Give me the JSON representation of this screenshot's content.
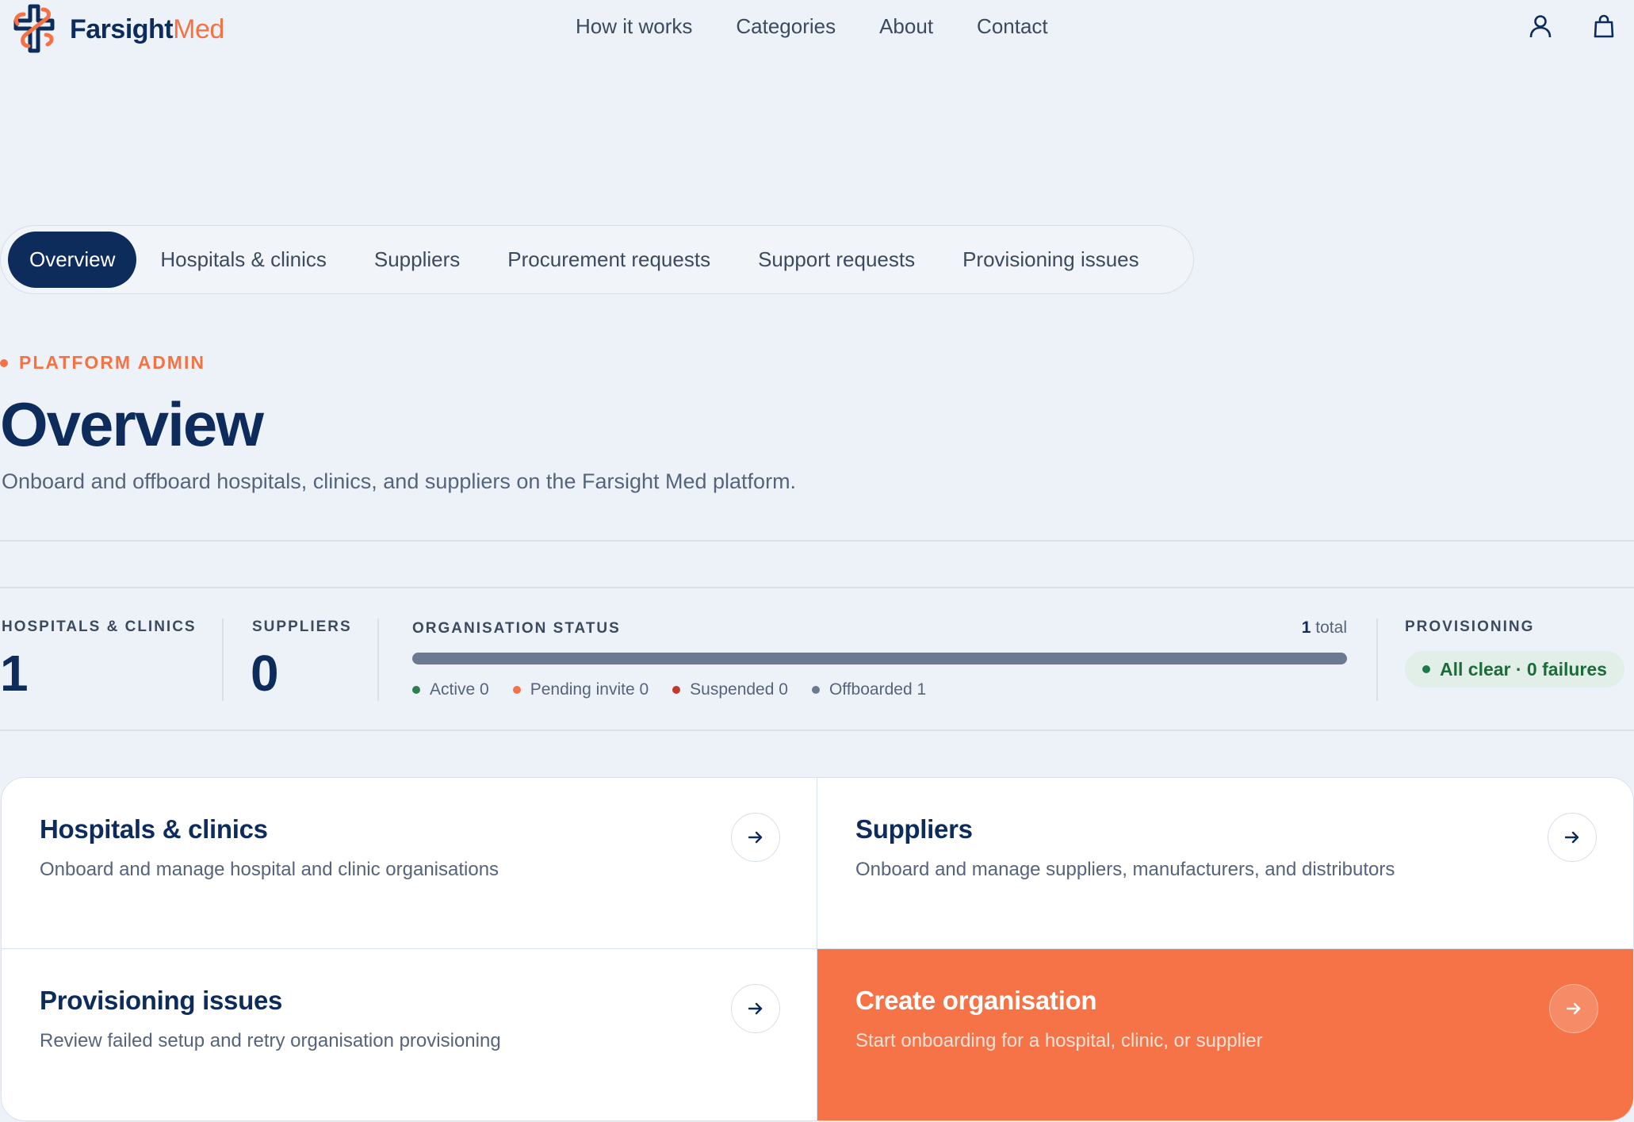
{
  "brand": {
    "name_part1": "Farsight",
    "name_part2": "Med"
  },
  "nav": {
    "items": [
      "How it works",
      "Categories",
      "About",
      "Contact"
    ]
  },
  "header_icons": [
    "user-icon",
    "shopping-bag-icon"
  ],
  "tabs": [
    {
      "label": "Overview",
      "active": true
    },
    {
      "label": "Hospitals & clinics",
      "active": false
    },
    {
      "label": "Suppliers",
      "active": false
    },
    {
      "label": "Procurement requests",
      "active": false
    },
    {
      "label": "Support requests",
      "active": false
    },
    {
      "label": "Provisioning issues",
      "active": false
    }
  ],
  "page": {
    "eyebrow": "PLATFORM ADMIN",
    "title": "Overview",
    "subtitle": "Onboard and offboard hospitals, clinics, and suppliers on the Farsight Med platform."
  },
  "stats": {
    "hospitals": {
      "label": "HOSPITALS & CLINICS",
      "value": "1"
    },
    "suppliers": {
      "label": "SUPPLIERS",
      "value": "0"
    },
    "org_status": {
      "label": "ORGANISATION STATUS",
      "total_value": "1",
      "total_suffix": "total",
      "legend": [
        {
          "label": "Active 0",
          "color": "#2e7d4f"
        },
        {
          "label": "Pending invite 0",
          "color": "#f47244"
        },
        {
          "label": "Suspended 0",
          "color": "#c0392b"
        },
        {
          "label": "Offboarded 1",
          "color": "#6b7a90"
        }
      ]
    },
    "provisioning": {
      "label": "PROVISIONING",
      "status": "All clear · 0 failures"
    }
  },
  "cards": [
    {
      "title": "Hospitals & clinics",
      "desc": "Onboard and manage hospital and clinic organisations"
    },
    {
      "title": "Suppliers",
      "desc": "Onboard and manage suppliers, manufacturers, and distributors"
    },
    {
      "title": "Provisioning issues",
      "desc": "Review failed setup and retry organisation provisioning"
    },
    {
      "title": "Create organisation",
      "desc": "Start onboarding for a hospital, clinic, or supplier"
    }
  ],
  "colors": {
    "navy": "#0d2c5b",
    "accent": "#f47244",
    "background": "#edf2f9"
  }
}
